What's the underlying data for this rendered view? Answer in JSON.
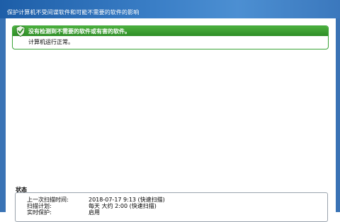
{
  "header": {
    "title": "保护计算机不受间谍软件和可能不需要的软件的影响"
  },
  "status": {
    "heading": "没有检测到不需要的软件或有害的软件。",
    "detail": "计算机运行正常。",
    "color": "#3a9e32"
  },
  "info": {
    "title": "状态",
    "rows": [
      {
        "label": "上一次扫描时间:",
        "value": "2018-07-17 9:13 (快速扫描)"
      },
      {
        "label": "扫描计划:",
        "value": "每天 大约 2:00 (快速扫描)"
      },
      {
        "label": "实时保护:",
        "value": "启用"
      }
    ]
  },
  "icons": {
    "status": "shield-check-icon"
  }
}
